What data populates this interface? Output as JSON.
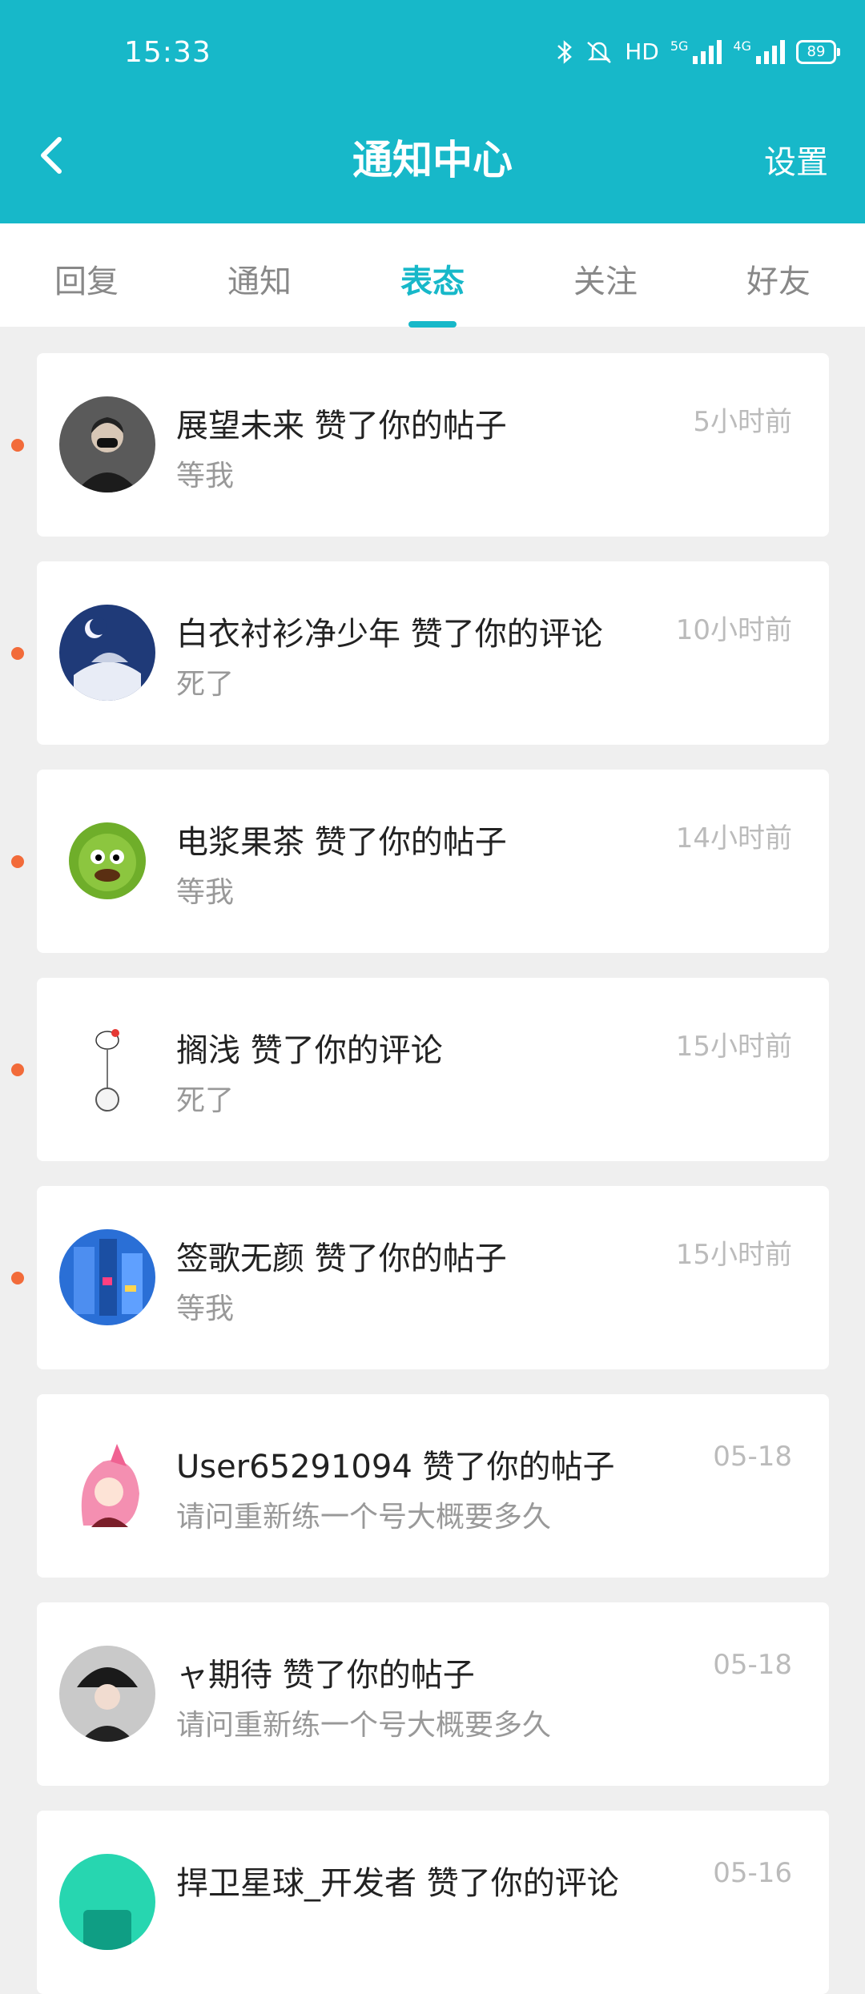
{
  "status_bar": {
    "time": "15:33",
    "network": "HD",
    "gen1": "5G",
    "gen2": "4G",
    "battery": "89"
  },
  "header": {
    "title": "通知中心",
    "settings_label": "设置"
  },
  "tabs": [
    {
      "label": "回复"
    },
    {
      "label": "通知"
    },
    {
      "label": "表态",
      "active": true
    },
    {
      "label": "关注"
    },
    {
      "label": "好友"
    }
  ],
  "notifications": [
    {
      "title": "展望未来 赞了你的帖子",
      "subtitle": "等我",
      "time": "5小时前",
      "unread": true
    },
    {
      "title": "白衣衬衫净少年 赞了你的评论",
      "subtitle": "死了",
      "time": "10小时前",
      "unread": true
    },
    {
      "title": "电浆果茶 赞了你的帖子",
      "subtitle": "等我",
      "time": "14小时前",
      "unread": true
    },
    {
      "title": "搁浅 赞了你的评论",
      "subtitle": "死了",
      "time": "15小时前",
      "unread": true
    },
    {
      "title": "签歌无颜 赞了你的帖子",
      "subtitle": "等我",
      "time": "15小时前",
      "unread": true
    },
    {
      "title": "User65291094 赞了你的帖子",
      "subtitle": "请问重新练一个号大概要多久",
      "time": "05-18",
      "unread": false
    },
    {
      "title": "ャ期待 赞了你的帖子",
      "subtitle": "请问重新练一个号大概要多久",
      "time": "05-18",
      "unread": false
    },
    {
      "title": "捍卫星球_开发者 赞了你的评论",
      "subtitle": "",
      "time": "05-16",
      "unread": false
    }
  ],
  "colors": {
    "accent": "#17b8c9",
    "unread_dot": "#f26b3a",
    "background": "#efefef"
  }
}
